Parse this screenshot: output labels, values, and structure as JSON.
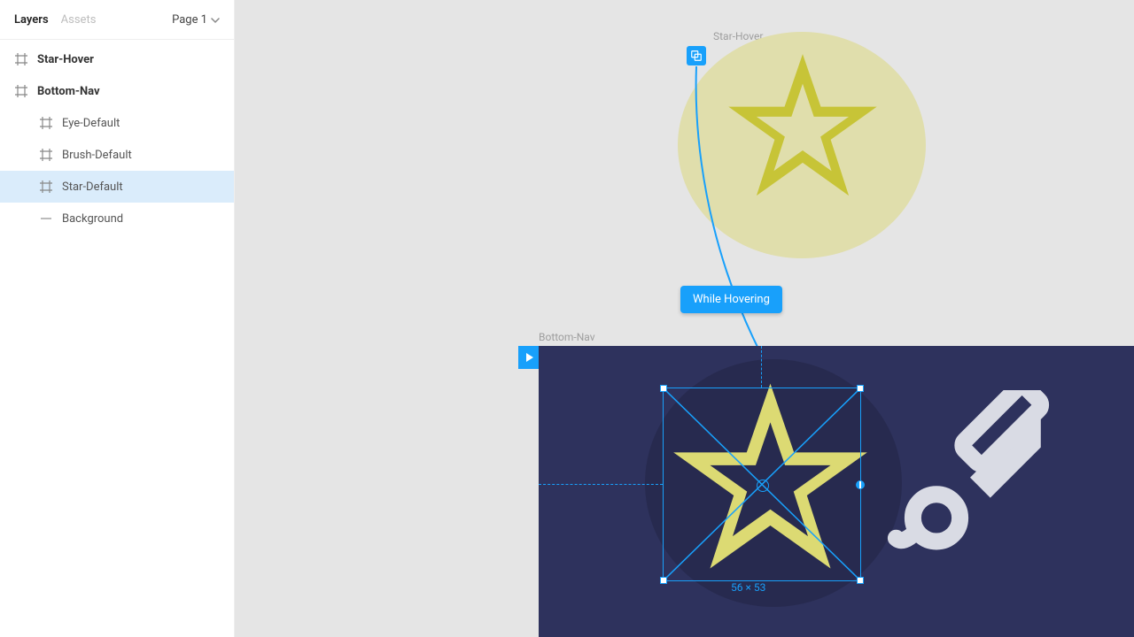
{
  "sidebar": {
    "tabs": {
      "layers": "Layers",
      "assets": "Assets"
    },
    "page_label": "Page 1",
    "items": [
      {
        "label": "Star-Hover",
        "type": "frame",
        "indent": 0,
        "bold": true,
        "selected": false
      },
      {
        "label": "Bottom-Nav",
        "type": "frame",
        "indent": 0,
        "bold": true,
        "selected": false
      },
      {
        "label": "Eye-Default",
        "type": "frame",
        "indent": 1,
        "bold": false,
        "selected": false
      },
      {
        "label": "Brush-Default",
        "type": "frame",
        "indent": 1,
        "bold": false,
        "selected": false
      },
      {
        "label": "Star-Default",
        "type": "frame",
        "indent": 1,
        "bold": false,
        "selected": true
      },
      {
        "label": "Background",
        "type": "rect",
        "indent": 1,
        "bold": false,
        "selected": false
      }
    ]
  },
  "canvas": {
    "hover_frame_label": "Star-Hover",
    "bottom_frame_label": "Bottom-Nav",
    "interaction_label": "While Hovering",
    "selection_dimensions": "56 × 53"
  },
  "colors": {
    "accent": "#18a0fb",
    "nav_bg": "#2e325d",
    "star_fill": "#c7c437",
    "canvas_bg": "#e5e5e5",
    "hover_circle": "#e0deac"
  }
}
